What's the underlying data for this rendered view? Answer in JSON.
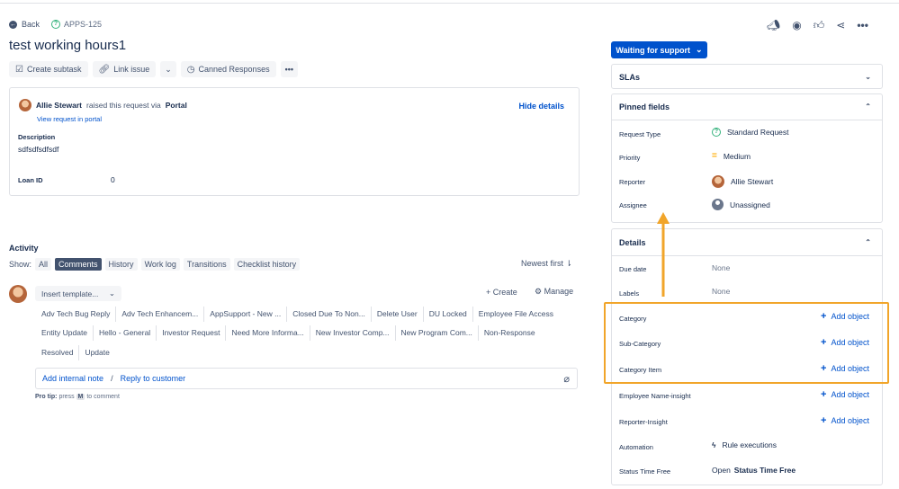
{
  "nav": {
    "back_label": "Back",
    "issue_key": "APPS-125"
  },
  "issue": {
    "title": "test working hours1"
  },
  "toolbar": {
    "create_subtask": "Create subtask",
    "link_issue": "Link issue",
    "canned_responses": "Canned Responses"
  },
  "details_card": {
    "reporter": "Allie Stewart",
    "raised_text": "raised this request via",
    "channel": "Portal",
    "view_request": "View request in portal",
    "hide_details": "Hide details",
    "description_label": "Description",
    "description_value": "sdfsdfsdfsdf",
    "loan_label": "Loan ID",
    "loan_value": "0"
  },
  "activity": {
    "title": "Activity",
    "show_label": "Show:",
    "filters": [
      "All",
      "Comments",
      "History",
      "Work log",
      "Transitions",
      "Checklist history"
    ],
    "selected_filter": "Comments",
    "sort_label": "Newest first",
    "insert_template": "Insert template...",
    "create_label": "Create",
    "manage_label": "Manage",
    "canned_rows": [
      [
        "Adv Tech Bug Reply",
        "Adv Tech Enhancem...",
        "AppSupport - New ...",
        "Closed Due To Non...",
        "Delete User",
        "DU Locked",
        "Employee File Access"
      ],
      [
        "Entity Update",
        "Hello - General",
        "Investor Request",
        "Need More Informa...",
        "New Investor Comp...",
        "New Program Com...",
        "Non-Response"
      ],
      [
        "Resolved",
        "Update"
      ]
    ],
    "add_internal_note": "Add internal note",
    "separator": "/",
    "reply_to_customer": "Reply to customer",
    "protip_label": "Pro tip:",
    "protip_press": "press",
    "protip_key": "M",
    "protip_rest": "to comment"
  },
  "sidebar": {
    "status": "Waiting for support",
    "slas_title": "SLAs",
    "pinned_title": "Pinned fields",
    "pinned_fields": [
      {
        "label": "Request Type",
        "value": "Standard Request",
        "icon": "question-circle-icon"
      },
      {
        "label": "Priority",
        "value": "Medium",
        "icon": "priority-medium-icon"
      },
      {
        "label": "Reporter",
        "value": "Allie Stewart",
        "icon": "avatar"
      },
      {
        "label": "Assignee",
        "value": "Unassigned",
        "icon": "unassigned-avatar-icon"
      }
    ],
    "details_title": "Details",
    "due_date_label": "Due date",
    "due_date_value": "None",
    "labels_label": "Labels",
    "labels_value": "None",
    "category_label": "Category",
    "subcategory_label": "Sub-Category",
    "category_item_label": "Category Item",
    "employee_name_label": "Employee Name-insight",
    "reporter_insight_label": "Reporter-Insight",
    "add_object": "Add object",
    "automation_label": "Automation",
    "automation_value": "Rule executions",
    "status_time_label": "Status Time Free",
    "status_time_prefix": "Open",
    "status_time_value": "Status Time Free"
  },
  "colors": {
    "primary": "#0052cc",
    "highlight": "#f1a52a",
    "text": "#172b4d",
    "subtle": "#42526e"
  }
}
